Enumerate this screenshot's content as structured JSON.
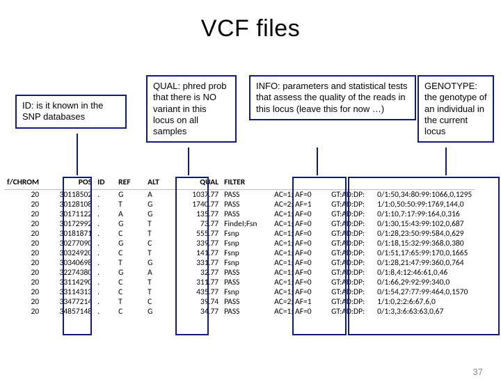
{
  "title": "VCF files",
  "page_number": "37",
  "callouts": {
    "id": "ID: is it known in the SNP databases",
    "qual": "QUAL: phred prob that there is NO variant in this locus on all samples",
    "info": "INFO: parameters and statistical tests that assess the quality of the reads in this locus (leave this for now …)",
    "geno": "GENOTYPE: the genotype of an individual in the current locus"
  },
  "table": {
    "headers": [
      "f/CHROM",
      "POS",
      "ID",
      "REF",
      "ALT",
      "QUAL",
      "FILTER",
      "",
      "",
      ""
    ],
    "rows": [
      [
        "20",
        "30118502",
        ".",
        "G",
        "A",
        "1037.77",
        "PASS",
        "AC=1; AF=0",
        "GT:AD:DP:",
        "0/1:50,34:80:99:1066,0,1295"
      ],
      [
        "20",
        "30128108",
        ".",
        "T",
        "G",
        "1740.77",
        "PASS",
        "AC=2; AF=1",
        "GT:AD:DP:",
        "1/1:0,50:50:99:1769,144,0"
      ],
      [
        "20",
        "30171122",
        ".",
        "A",
        "G",
        "135.77",
        "PASS",
        "AC=1; AF=0",
        "GT:AD:DP:",
        "0/1:10,7:17:99:164,0,316"
      ],
      [
        "20",
        "30172992",
        ".",
        "G",
        "T",
        "73.77",
        "FindeI;Fsn",
        "AC=1; AF=0",
        "GT:AD:DP:",
        "0/1:30,15:43:99:102,0,687"
      ],
      [
        "20",
        "30181871",
        ".",
        "C",
        "T",
        "555.77",
        "Fsnp",
        "AC=1; AF=0",
        "GT:AD:DP:",
        "0/1:28,23:50:99:584,0,629"
      ],
      [
        "20",
        "30277090",
        ".",
        "G",
        "C",
        "339.77",
        "Fsnp",
        "AC=1; AF=0",
        "GT:AD:DP:",
        "0/1:18,15:32:99:368,0,380"
      ],
      [
        "20",
        "30324920",
        ".",
        "C",
        "T",
        "141.77",
        "Fsnp",
        "AC=1; AF=0",
        "GT:AD:DP:",
        "0/1:51,17:65:99:170,0,1665"
      ],
      [
        "20",
        "30340698",
        ".",
        "T",
        "G",
        "331.77",
        "Fsnp",
        "AC=1; AF=0",
        "GT:AD:DP:",
        "0/1:28,21:47:99:360,0,764"
      ],
      [
        "20",
        "32274380",
        ".",
        "G",
        "A",
        "32.77",
        "PASS",
        "AC=1; AF=0",
        "GT:AD:DP:",
        "0/1:8,4:12:46:61,0,46"
      ],
      [
        "20",
        "33114290",
        ".",
        "C",
        "T",
        "311.77",
        "PASS",
        "AC=1; AF=0",
        "GT:AD:DP:",
        "0/1:66,29:92:99:340,0"
      ],
      [
        "20",
        "33114313",
        ".",
        "C",
        "T",
        "435.77",
        "Fsnp",
        "AC=1; AF=0",
        "GT:AD:DP:",
        "0/1:54,27:77:99:464,0,1570"
      ],
      [
        "20",
        "33477214",
        ".",
        "T",
        "C",
        "39.74",
        "PASS",
        "AC=2; AF=1",
        "GT:AD:DP:",
        "1/1:0,2:2:6:67,6,0"
      ],
      [
        "20",
        "34857148",
        ".",
        "C",
        "G",
        "34.77",
        "PASS",
        "AC=1; AF=0",
        "GT:AD:DP:",
        "0/1:3,3:6:63:63,0,67"
      ]
    ]
  }
}
